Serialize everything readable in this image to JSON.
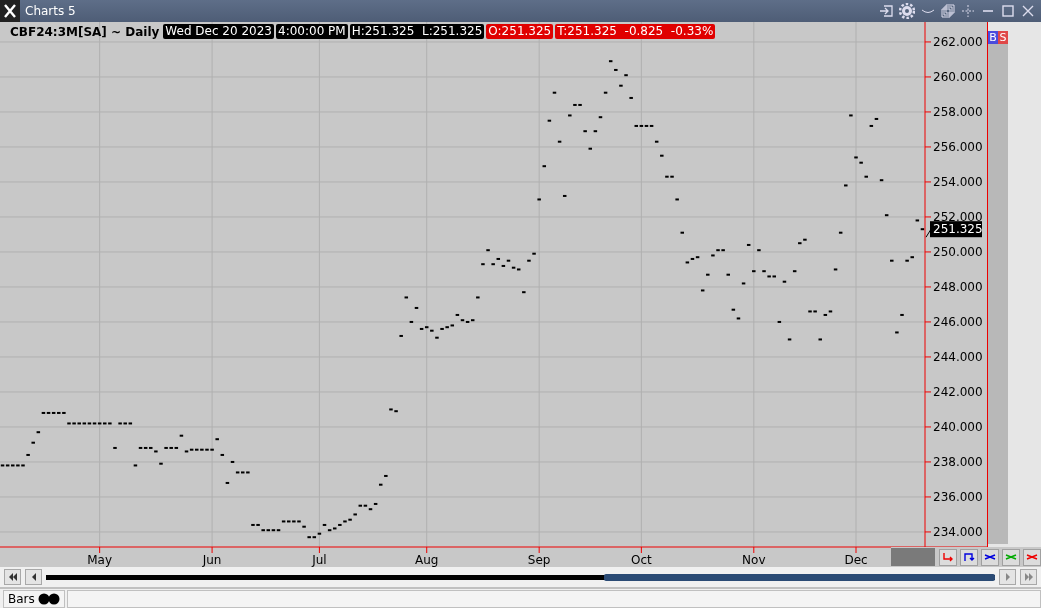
{
  "window": {
    "title": "Charts 5"
  },
  "header": {
    "symbol": "CBF24:3M[SA] ~ Daily",
    "fields": [
      {
        "text": "Wed Dec 20 2023",
        "color": "#000000"
      },
      {
        "text": "4:00:00 PM",
        "color": "#000000"
      },
      {
        "text": "H:251.325  L:251.325",
        "color": "#000000"
      },
      {
        "text": "O:251.325",
        "color": "#e00000"
      },
      {
        "text": "T:251.325  -0.825  -0.33%",
        "color": "#e00000"
      }
    ]
  },
  "price_label": "251.325",
  "side_badges": [
    {
      "text": "B",
      "color": "#4b4bdc"
    },
    {
      "text": "S",
      "color": "#e04848"
    }
  ],
  "chart_data": {
    "type": "scatter",
    "ylim": [
      233.14,
      263.14
    ],
    "grid": true,
    "yticks": [
      {
        "value": 234,
        "label": "234.000"
      },
      {
        "value": 236,
        "label": "236.000"
      },
      {
        "value": 238,
        "label": "238.000"
      },
      {
        "value": 240,
        "label": "240.000"
      },
      {
        "value": 242,
        "label": "242.000"
      },
      {
        "value": 244,
        "label": "244.000"
      },
      {
        "value": 246,
        "label": "246.000"
      },
      {
        "value": 248,
        "label": "248.000"
      },
      {
        "value": 250,
        "label": "250.000"
      },
      {
        "value": 252,
        "label": "252.000"
      },
      {
        "value": 254,
        "label": "254.000"
      },
      {
        "value": 256,
        "label": "256.000"
      },
      {
        "value": 258,
        "label": "258.000"
      },
      {
        "value": 260,
        "label": "260.000"
      },
      {
        "value": 262,
        "label": "262.000"
      }
    ],
    "categories": [
      null,
      null,
      null,
      null,
      null,
      null,
      null,
      null,
      null,
      null,
      null,
      null,
      null,
      null,
      null,
      null,
      null,
      null,
      null,
      "May",
      null,
      null,
      null,
      null,
      null,
      null,
      null,
      null,
      null,
      null,
      null,
      null,
      null,
      null,
      null,
      null,
      null,
      null,
      null,
      null,
      null,
      "Jun",
      null,
      null,
      null,
      null,
      null,
      null,
      null,
      null,
      null,
      null,
      null,
      null,
      null,
      null,
      null,
      null,
      null,
      null,
      null,
      null,
      "Jul",
      null,
      null,
      null,
      null,
      null,
      null,
      null,
      null,
      null,
      null,
      null,
      null,
      null,
      null,
      null,
      null,
      null,
      null,
      null,
      null,
      "Aug",
      null,
      null,
      null,
      null,
      null,
      null,
      null,
      null,
      null,
      null,
      null,
      null,
      null,
      null,
      null,
      null,
      null,
      null,
      null,
      null,
      null,
      "Sep",
      null,
      null,
      null,
      null,
      null,
      null,
      null,
      null,
      null,
      null,
      null,
      null,
      null,
      null,
      null,
      null,
      null,
      null,
      null,
      "Oct",
      null,
      null,
      null,
      null,
      null,
      null,
      null,
      null,
      null,
      null,
      null,
      null,
      null,
      null,
      null,
      null,
      null,
      null,
      null,
      null,
      null,
      "Nov",
      null,
      null,
      null,
      null,
      null,
      null,
      null,
      null,
      null,
      null,
      null,
      null,
      null,
      null,
      null,
      null,
      null,
      null,
      null,
      "Dec",
      null,
      null,
      null,
      null,
      null,
      null,
      null,
      null,
      null,
      null,
      null,
      null,
      null
    ],
    "series": [
      {
        "color": "#000000",
        "values": [
          237.8,
          237.8,
          237.8,
          237.8,
          237.8,
          238.4,
          239.1,
          239.7,
          240.8,
          240.8,
          240.8,
          240.8,
          240.8,
          240.2,
          240.2,
          240.2,
          240.2,
          240.2,
          240.2,
          240.2,
          240.2,
          240.2,
          238.8,
          240.2,
          240.2,
          240.2,
          237.8,
          238.8,
          238.8,
          238.8,
          238.6,
          237.9,
          238.8,
          238.8,
          238.8,
          239.5,
          238.6,
          238.7,
          238.7,
          238.7,
          238.7,
          238.7,
          239.3,
          238.4,
          236.8,
          238.0,
          237.4,
          237.4,
          237.4,
          234.4,
          234.4,
          234.1,
          234.1,
          234.1,
          234.1,
          234.6,
          234.6,
          234.6,
          234.6,
          234.3,
          233.7,
          233.7,
          233.9,
          234.4,
          234.1,
          234.2,
          234.4,
          234.6,
          234.7,
          235.0,
          235.5,
          235.5,
          235.3,
          235.6,
          236.7,
          237.2,
          241.0,
          240.9,
          245.2,
          247.4,
          246.0,
          246.8,
          245.6,
          245.7,
          245.5,
          245.1,
          245.6,
          245.7,
          245.8,
          246.4,
          246.1,
          246.0,
          246.1,
          247.4,
          249.3,
          250.1,
          249.3,
          249.6,
          249.2,
          249.5,
          249.1,
          249.0,
          247.7,
          249.5,
          249.9,
          253.0,
          254.9,
          257.5,
          259.1,
          256.3,
          253.2,
          257.8,
          258.4,
          258.4,
          256.9,
          255.9,
          256.9,
          257.7,
          259.1,
          260.9,
          260.4,
          259.5,
          260.1,
          258.8,
          257.2,
          257.2,
          257.2,
          257.2,
          256.3,
          255.5,
          254.3,
          254.3,
          253.0,
          251.1,
          249.4,
          249.6,
          249.7,
          247.8,
          248.7,
          249.8,
          250.1,
          250.1,
          248.7,
          246.7,
          246.2,
          248.2,
          250.4,
          248.9,
          250.1,
          248.9,
          248.6,
          248.6,
          246.0,
          248.3,
          245.0,
          248.9,
          250.5,
          250.7,
          246.6,
          246.6,
          245.0,
          246.4,
          246.6,
          249.0,
          251.1,
          253.8,
          257.8,
          255.4,
          255.1,
          254.3,
          257.2,
          257.6,
          254.1,
          252.1,
          249.5,
          245.4,
          246.4,
          249.5,
          249.7,
          251.8,
          251.3
        ]
      }
    ]
  },
  "bottom_tab": {
    "label": "Bars"
  }
}
